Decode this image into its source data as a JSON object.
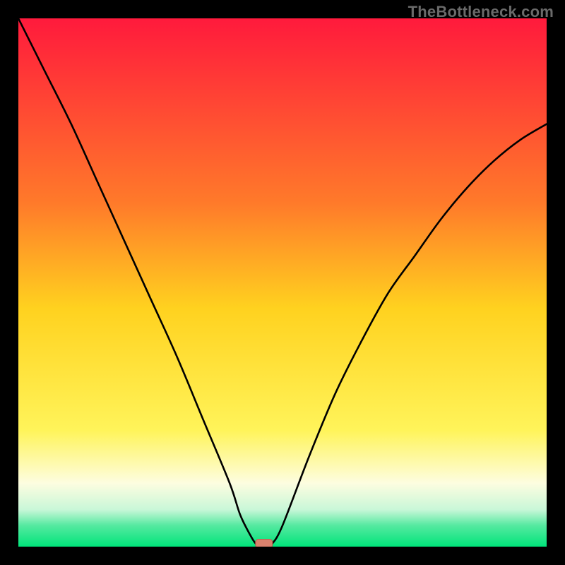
{
  "watermark": "TheBottleneck.com",
  "colors": {
    "frame": "#000000",
    "gradient_stops": [
      {
        "offset": 0.0,
        "color": "#ff1a3c"
      },
      {
        "offset": 0.35,
        "color": "#ff7a2a"
      },
      {
        "offset": 0.55,
        "color": "#ffd21f"
      },
      {
        "offset": 0.78,
        "color": "#fff45a"
      },
      {
        "offset": 0.88,
        "color": "#fdfde0"
      },
      {
        "offset": 0.93,
        "color": "#c9f7d8"
      },
      {
        "offset": 0.96,
        "color": "#55e9a0"
      },
      {
        "offset": 1.0,
        "color": "#00e47a"
      }
    ],
    "curve": "#000000",
    "marker_fill": "#d9816d",
    "marker_stroke": "#b85f4d"
  },
  "chart_data": {
    "type": "line",
    "title": "",
    "xlabel": "",
    "ylabel": "",
    "xlim": [
      0,
      100
    ],
    "ylim": [
      0,
      100
    ],
    "grid": false,
    "legend": false,
    "note": "V-shaped bottleneck curve; y is mismatch severity (0 = optimal). Values read off the plot; approximate.",
    "x": [
      0,
      5,
      10,
      15,
      20,
      25,
      30,
      35,
      40,
      42,
      44,
      45,
      46,
      47,
      48,
      50,
      55,
      60,
      65,
      70,
      75,
      80,
      85,
      90,
      95,
      100
    ],
    "y": [
      100,
      90,
      80,
      69,
      58,
      47,
      36,
      24,
      12,
      6,
      2,
      0.5,
      0,
      0,
      0.5,
      4,
      17,
      29,
      39,
      48,
      55,
      62,
      68,
      73,
      77,
      80
    ],
    "optimal_marker": {
      "x": 46.5,
      "y": 0.6,
      "shape": "rounded-rect"
    }
  }
}
